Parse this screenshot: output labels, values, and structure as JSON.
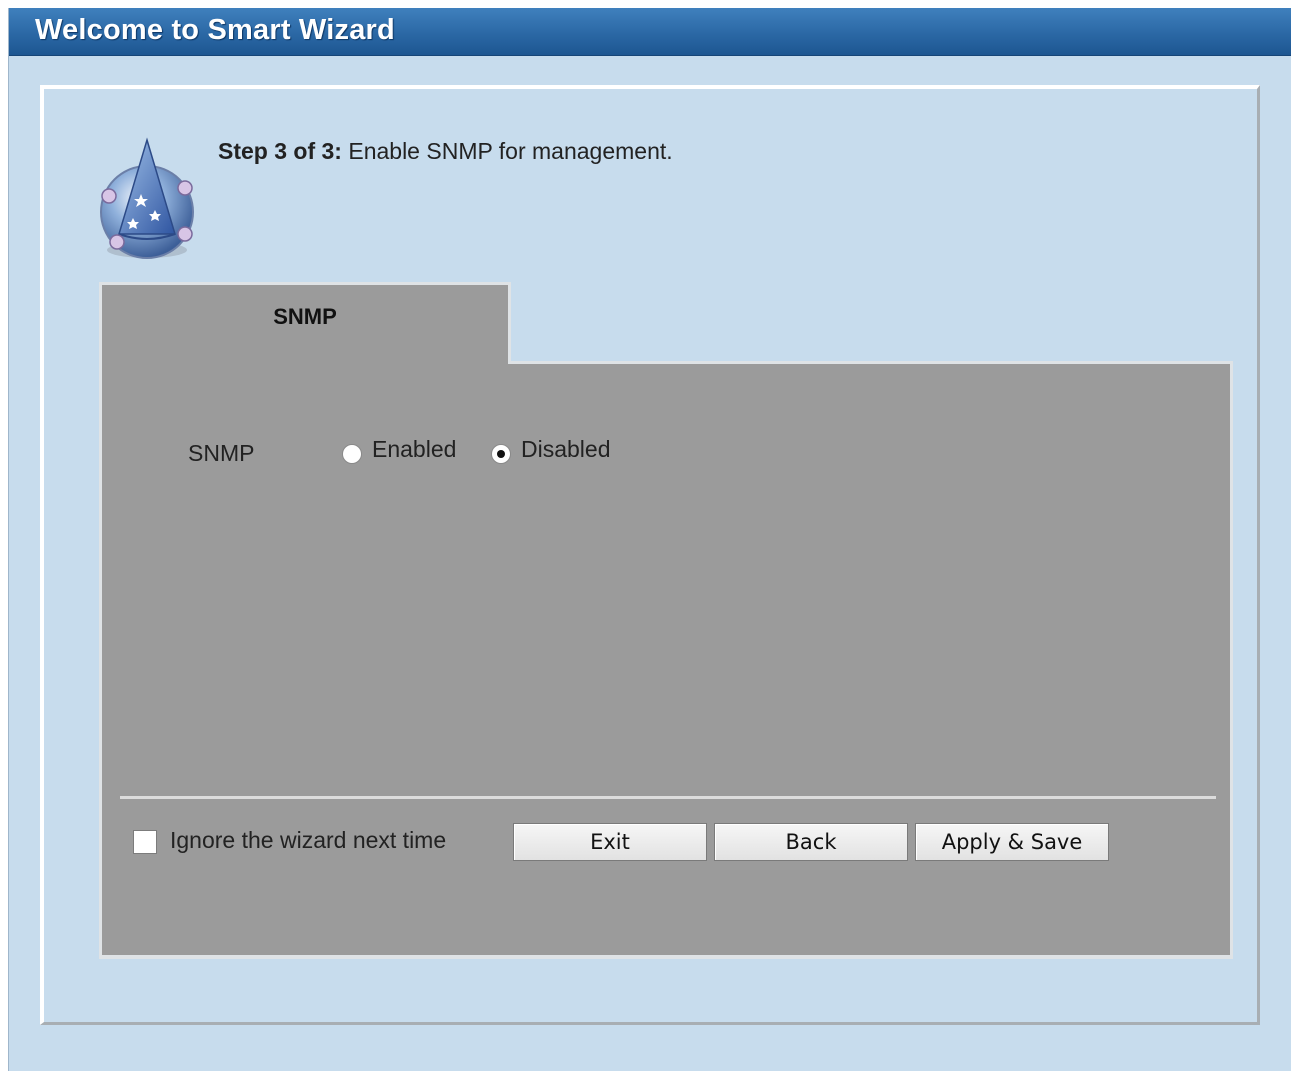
{
  "window": {
    "title": "Welcome to Smart Wizard"
  },
  "header": {
    "step_prefix": "Step 3 of 3:",
    "step_text": " Enable SNMP for management."
  },
  "icons": {
    "wizard": "wizard-hat-icon"
  },
  "tab": {
    "label": "SNMP"
  },
  "snmp": {
    "label": "SNMP",
    "options": [
      {
        "label": "Enabled",
        "checked": false
      },
      {
        "label": "Disabled",
        "checked": true
      }
    ]
  },
  "footer": {
    "ignore_label": "Ignore the wizard next time",
    "ignore_checked": false,
    "buttons": {
      "exit": "Exit",
      "back": "Back",
      "apply_save": "Apply & Save"
    }
  },
  "colors": {
    "title_bar": "#2b68a5",
    "background": "#c7dced",
    "panel": "#9b9b9b"
  }
}
